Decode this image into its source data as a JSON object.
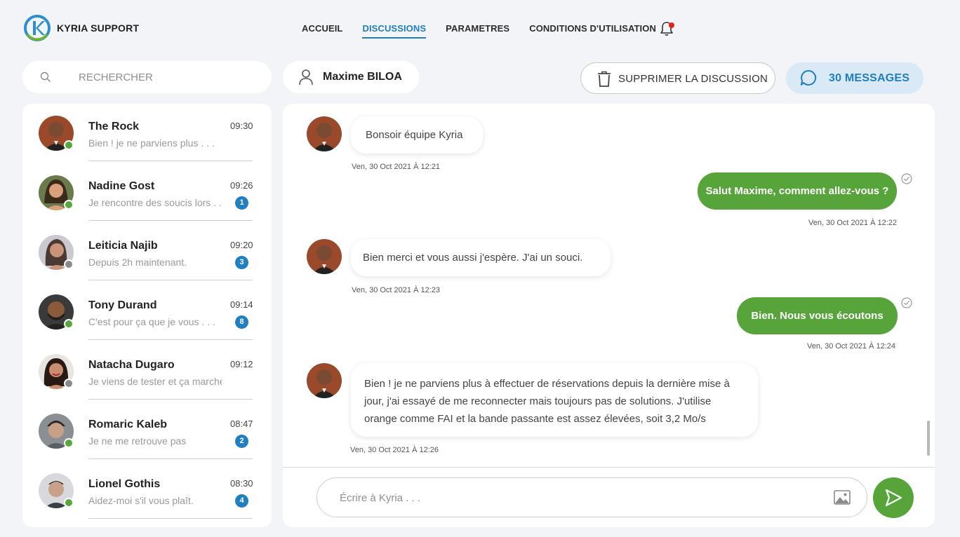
{
  "brand": {
    "name": "KYRIA SUPPORT"
  },
  "nav": {
    "items": [
      {
        "label": "ACCUEIL",
        "active": false
      },
      {
        "label": "DISCUSSIONS",
        "active": true
      },
      {
        "label": "PARAMETRES",
        "active": false
      },
      {
        "label": "CONDITIONS D'UTILISATION",
        "active": false
      }
    ],
    "notification_icon": "bell-icon"
  },
  "search": {
    "placeholder": "RECHERCHER"
  },
  "conversations": [
    {
      "name": "The Rock",
      "time": "09:30",
      "preview": "Bien ! je ne parviens plus  . . .",
      "unread": "",
      "status": "online"
    },
    {
      "name": "Nadine Gost",
      "time": "09:26",
      "preview": "Je rencontre des soucis lors . . .",
      "unread": "1",
      "status": "online"
    },
    {
      "name": "Leiticia Najib",
      "time": "09:20",
      "preview": "Depuis 2h maintenant.",
      "unread": "3",
      "status": "offline"
    },
    {
      "name": "Tony Durand",
      "time": "09:14",
      "preview": "C'est pour ça que  je vous . . .",
      "unread": "8",
      "status": "online"
    },
    {
      "name": "Natacha Dugaro",
      "time": "09:12",
      "preview": "Je viens de tester et ça marche.",
      "unread": "",
      "status": "offline"
    },
    {
      "name": "Romaric Kaleb",
      "time": "08:47",
      "preview": "Je ne me retrouve pas",
      "unread": "2",
      "status": "online"
    },
    {
      "name": "Lionel Gothis",
      "time": "08:30",
      "preview": "Aidez-moi s'il vous plaît.",
      "unread": "4",
      "status": "online"
    }
  ],
  "chat_header": {
    "user_name": "Maxime BILOA",
    "delete_label": "SUPPRIMER LA DISCUSSION",
    "messages_label": "30 MESSAGES"
  },
  "messages": [
    {
      "direction": "in",
      "text": "Bonsoir équipe Kyria",
      "timestamp": "Ven, 30 Oct 2021 À 12:21"
    },
    {
      "direction": "out",
      "text": "Salut Maxime, comment allez-vous ?",
      "timestamp": "Ven, 30 Oct 2021 À 12:22"
    },
    {
      "direction": "in",
      "text": "Bien merci et vous aussi j'espère.  J'ai un souci.",
      "timestamp": "Ven, 30 Oct 2021 À 12:23"
    },
    {
      "direction": "out",
      "text": "Bien. Nous vous écoutons",
      "timestamp": "Ven, 30 Oct 2021 À 12:24"
    },
    {
      "direction": "in",
      "lines": [
        "Bien ! je ne parviens plus à  effectuer de réservations  depuis la dernière mise à",
        "jour, j'ai essayé de me reconnecter mais toujours pas de solutions.  J'utilise",
        "orange comme FAI et la bande passante est assez élevées, soit 3,2 Mo/s"
      ],
      "timestamp": "Ven, 30 Oct 2021 À 12:26"
    }
  ],
  "composer": {
    "placeholder": "Écrire à Kyria . . ."
  },
  "colors": {
    "accent_blue": "#1f7fc0",
    "accent_green": "#56a43a",
    "online": "#56a83c",
    "offline": "#8a8a8a",
    "notification": "#e3231b"
  }
}
